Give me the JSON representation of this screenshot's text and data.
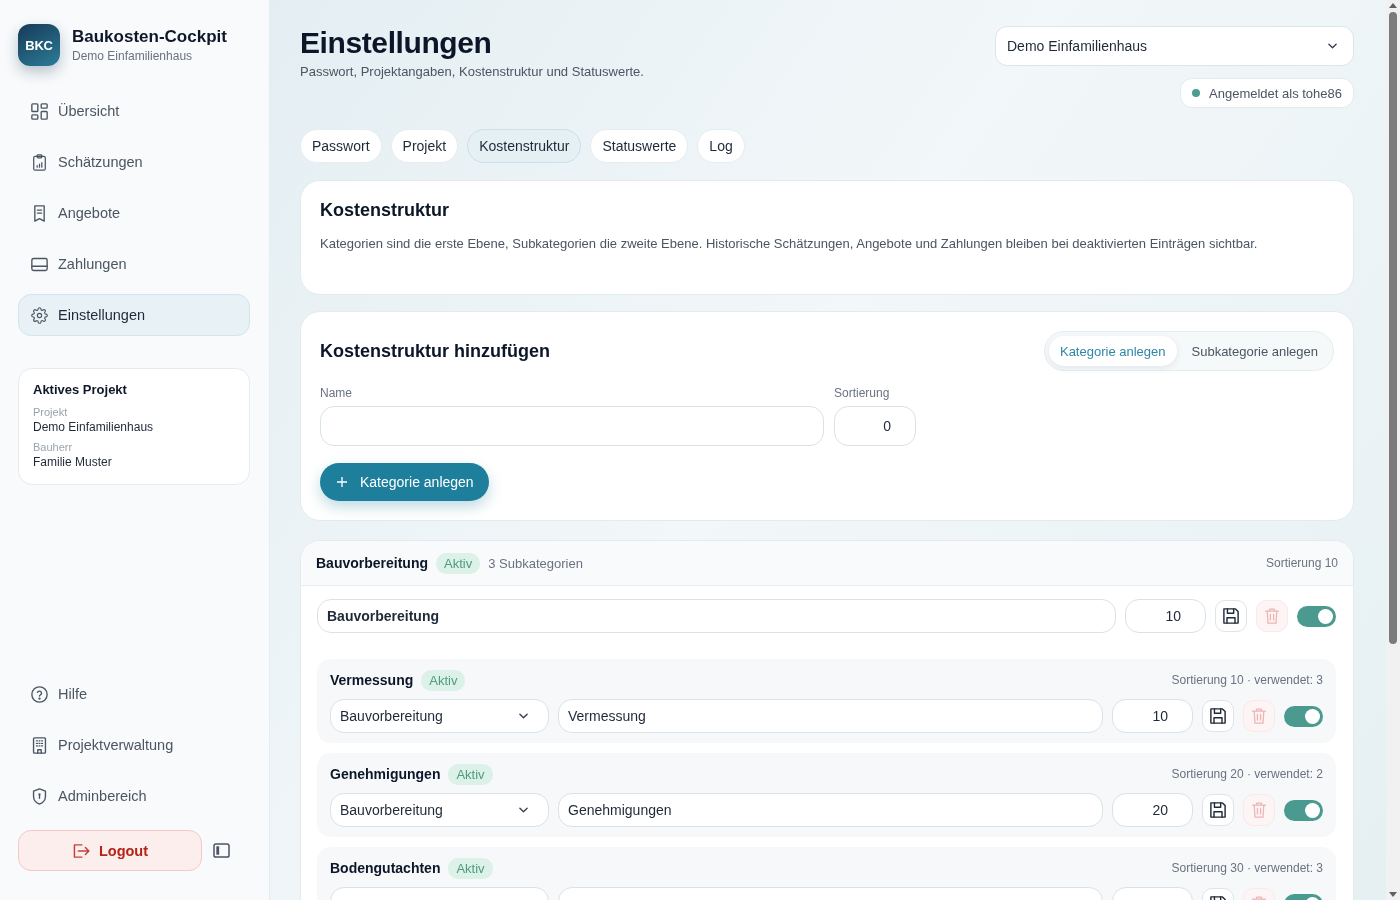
{
  "sidebar": {
    "logo": "BKC",
    "app_name": "Baukosten-Cockpit",
    "app_subtitle": "Demo Einfamilienhaus",
    "nav_items": [
      {
        "label": "Übersicht",
        "selected": false
      },
      {
        "label": "Schätzungen",
        "selected": false
      },
      {
        "label": "Angebote",
        "selected": false
      },
      {
        "label": "Zahlungen",
        "selected": false
      },
      {
        "label": "Einstellungen",
        "selected": true
      }
    ],
    "active_project": {
      "title": "Aktives Projekt",
      "fields": [
        {
          "label": "Projekt",
          "value": "Demo Einfamilienhaus"
        },
        {
          "label": "Bauherr",
          "value": "Familie Muster"
        }
      ]
    },
    "bottom_items": [
      {
        "label": "Hilfe",
        "selected": false
      },
      {
        "label": "Projektverwaltung",
        "selected": false
      },
      {
        "label": "Adminbereich",
        "selected": false
      }
    ],
    "logout": "Logout"
  },
  "header": {
    "title": "Einstellungen",
    "subtitle": "Passwort, Projektangaben, Kostenstruktur und Statuswerte.",
    "project_select": "Demo Einfamilienhaus",
    "login_status": "Angemeldet als tohe86"
  },
  "tabs": [
    {
      "label": "Passwort",
      "selected": false
    },
    {
      "label": "Projekt",
      "selected": false
    },
    {
      "label": "Kostenstruktur",
      "selected": true
    },
    {
      "label": "Statuswerte",
      "selected": false
    },
    {
      "label": "Log",
      "selected": false
    }
  ],
  "intro_card": {
    "title": "Kostenstruktur",
    "description": "Kategorien sind die erste Ebene, Subkategorien die zweite Ebene. Historische Schätzungen, Angebote und Zahlungen bleiben bei deaktivierten Einträgen sichtbar."
  },
  "add_card": {
    "title": "Kostenstruktur hinzufügen",
    "modes": [
      {
        "label": "Kategorie anlegen",
        "selected": true
      },
      {
        "label": "Subkategorie anlegen",
        "selected": false
      }
    ],
    "name_label": "Name",
    "sort_label": "Sortierung",
    "sort_value": "0",
    "submit": "Kategorie anlegen"
  },
  "category": {
    "name": "Bauvorbereitung",
    "status": "Aktiv",
    "count": "3 Subkategorien",
    "meta": "Sortierung 10",
    "name_value": "Bauvorbereitung",
    "sort_value": "10",
    "delete_disabled": true,
    "on": true,
    "subcategories": [
      {
        "name": "Vermessung",
        "status": "Aktiv",
        "meta": "Sortierung 10 · verwendet: 3",
        "parent": "Bauvorbereitung",
        "value": "Vermessung",
        "sort_value": "10",
        "delete_disabled": true,
        "on": true
      },
      {
        "name": "Genehmigungen",
        "status": "Aktiv",
        "meta": "Sortierung 20 · verwendet: 2",
        "parent": "Bauvorbereitung",
        "value": "Genehmigungen",
        "sort_value": "20",
        "delete_disabled": true,
        "on": true
      },
      {
        "name": "Bodengutachten",
        "status": "Aktiv",
        "meta": "Sortierung 30 · verwendet: 3",
        "delete_disabled": true,
        "on": true
      }
    ]
  }
}
